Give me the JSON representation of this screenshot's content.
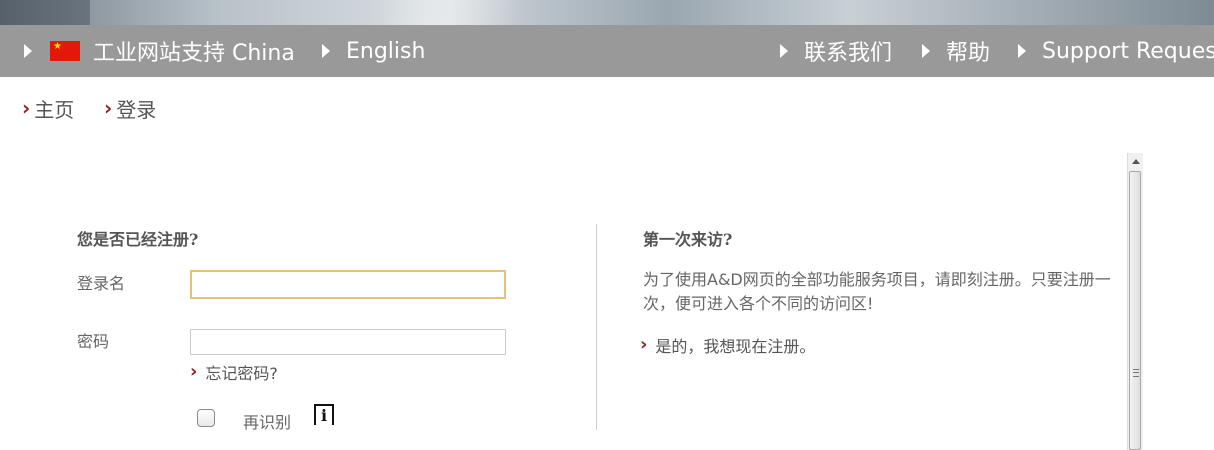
{
  "top_nav": {
    "left": [
      {
        "label": "工业网站支持 China",
        "icon": "china-flag-icon"
      },
      {
        "label": "English"
      }
    ],
    "right": [
      {
        "label": "联系我们"
      },
      {
        "label": "帮助"
      },
      {
        "label": "Support Request"
      }
    ]
  },
  "breadcrumb": [
    {
      "label": "主页"
    },
    {
      "label": "登录"
    }
  ],
  "login": {
    "heading": "您是否已经注册?",
    "username_label": "登录名",
    "username_value": "",
    "password_label": "密码",
    "password_value": "",
    "forgot_password": "忘记密码?",
    "remember_label": "再识别",
    "info_icon_glyph": "i"
  },
  "first_visit": {
    "heading": "第一次来访?",
    "description": "为了使用A&D网页的全部功能服务项目，请即刻注册。只要注册一次，便可进入各个不同的访问区!",
    "register_link": "是的，我想现在注册。"
  },
  "colors": {
    "nav_bar": "#999999",
    "accent_chevron": "#9b1b20",
    "focus_border": "#e3c27a"
  }
}
